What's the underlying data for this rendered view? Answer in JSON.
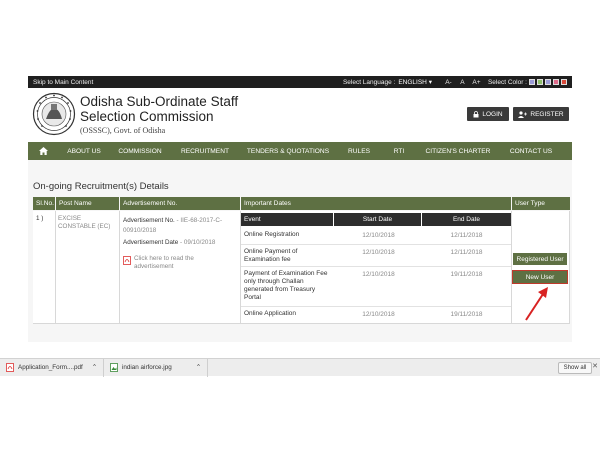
{
  "topbar": {
    "skip": "Skip to Main Content",
    "select_language_label": "Select Language :",
    "language_value": "ENGLISH",
    "font_small": "A-",
    "font_normal": "A",
    "font_large": "A+",
    "select_color_label": "Select Color :",
    "color_swatches": [
      "#9b9bd6",
      "#8fbf6a",
      "#9b9bd6",
      "#e06a8a",
      "#d94a3a"
    ]
  },
  "header": {
    "title_line1": "Odisha Sub-Ordinate Staff",
    "title_line2": "Selection Commission",
    "subtitle": "(OSSSC), Govt. of Odisha",
    "login_label": "LOGIN",
    "register_label": "REGISTER"
  },
  "nav": {
    "items": [
      "ABOUT US",
      "COMMISSION",
      "RECRUITMENT",
      "TENDERS & QUOTATIONS",
      "RULES",
      "RTI",
      "CITIZEN'S CHARTER",
      "CONTACT US"
    ]
  },
  "main": {
    "section_title": "On-going Recruitment(s) Details",
    "columns": [
      "Sl.No.",
      "Post Name",
      "Advertisement No.",
      "Important Dates",
      "User Type"
    ],
    "row": {
      "sl": "1 )",
      "post_name": "EXCISE CONSTABLE (EC)",
      "adv_label": "Advertisement No.",
      "adv_no": " - IIE-68-2017-C-00910/2018",
      "adv_date_label": "Advertisement Date",
      "adv_date": " - 09/10/2018",
      "read_link": "Click here to read the advertisement"
    },
    "dates_header": {
      "event": "Event",
      "start": "Start Date",
      "end": "End Date"
    },
    "events": [
      {
        "event": "Online Registration",
        "start": "12/10/2018",
        "end": "12/11/2018"
      },
      {
        "event": "Online Payment of Examination fee",
        "start": "12/10/2018",
        "end": "12/11/2018"
      },
      {
        "event": "Payment of Examination Fee only through Challan generated from Treasury Portal",
        "start": "12/10/2018",
        "end": "19/11/2018"
      },
      {
        "event": "Online Application",
        "start": "12/10/2018",
        "end": "19/11/2018"
      }
    ],
    "registered_user": "Registered User",
    "new_user": "New User"
  },
  "downloads": {
    "items": [
      {
        "name": "Application_Form....pdf",
        "icon": "pdf-icon"
      },
      {
        "name": "indian airforce.jpg",
        "icon": "image-file-icon"
      }
    ],
    "show_all": "Show all"
  }
}
